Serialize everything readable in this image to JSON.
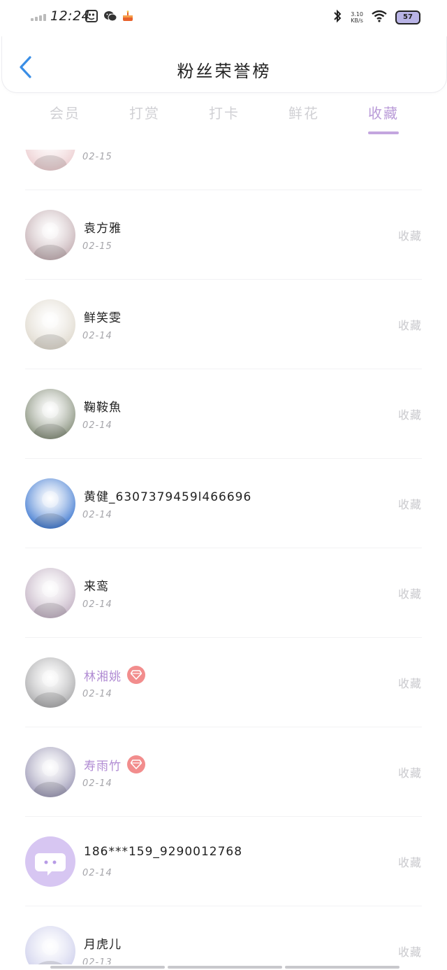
{
  "status_bar": {
    "time": "12:24",
    "net_speed_value": "3.10",
    "net_speed_unit": "KB/s",
    "battery": "57",
    "app_icons": [
      "gallery-icon",
      "wechat-icon",
      "cake-icon"
    ]
  },
  "header": {
    "title": "粉丝荣誉榜"
  },
  "tabs": [
    {
      "label": "会员",
      "active": false
    },
    {
      "label": "打赏",
      "active": false
    },
    {
      "label": "打卡",
      "active": false
    },
    {
      "label": "鲜花",
      "active": false
    },
    {
      "label": "收藏",
      "active": true
    }
  ],
  "rows": [
    {
      "name": "",
      "date": "02-15",
      "action": "",
      "vip": false,
      "avatar_color": "#e9c5c8"
    },
    {
      "name": "袁方雅",
      "date": "02-15",
      "action": "收藏",
      "vip": false,
      "avatar_color": "#b9a0a5"
    },
    {
      "name": "鲜笑雯",
      "date": "02-14",
      "action": "收藏",
      "vip": false,
      "avatar_color": "#d9d2c4"
    },
    {
      "name": "鞠鞍魚",
      "date": "02-14",
      "action": "收藏",
      "vip": false,
      "avatar_color": "#6f7a62"
    },
    {
      "name": "黄健_6307379459l466696",
      "date": "02-14",
      "action": "收藏",
      "vip": false,
      "avatar_color": "#1a5fc8"
    },
    {
      "name": "来鸾",
      "date": "02-14",
      "action": "收藏",
      "vip": false,
      "avatar_color": "#b7a3b8"
    },
    {
      "name": "林湘姚",
      "date": "02-14",
      "action": "收藏",
      "vip": true,
      "avatar_color": "#9a9a9c"
    },
    {
      "name": "寿雨竹",
      "date": "02-14",
      "action": "收藏",
      "vip": true,
      "avatar_color": "#8a86a8"
    },
    {
      "name": "186***159_9290012768",
      "date": "02-14",
      "action": "收藏",
      "vip": false,
      "avatar_color": "#d7c6f2"
    },
    {
      "name": "月虎儿",
      "date": "02-13",
      "action": "收藏",
      "vip": false,
      "avatar_color": "#c4c6e8"
    }
  ]
}
